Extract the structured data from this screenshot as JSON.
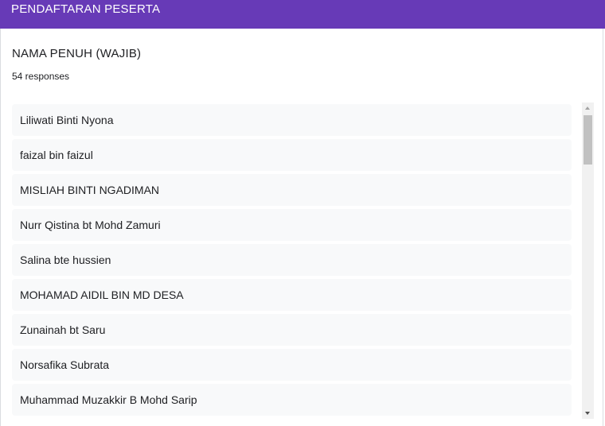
{
  "header": {
    "title": "PENDAFTARAN PESERTA",
    "color": "#673ab7"
  },
  "question": {
    "title": "NAMA PENUH (WAJIB)",
    "response_count": "54 responses"
  },
  "responses": [
    "Liliwati Binti Nyona",
    "faizal bin faizul",
    "MISLIAH BINTI NGADIMAN",
    "Nurr Qistina bt Mohd Zamuri",
    "Salina bte hussien",
    "MOHAMAD AIDIL BIN MD DESA",
    "Zunainah bt Saru",
    "Norsafika Subrata",
    "Muhammad Muzakkir B Mohd Sarip"
  ],
  "icons": {
    "scroll_up": "scroll-up-arrow-icon",
    "scroll_down": "scroll-down-arrow-icon"
  }
}
